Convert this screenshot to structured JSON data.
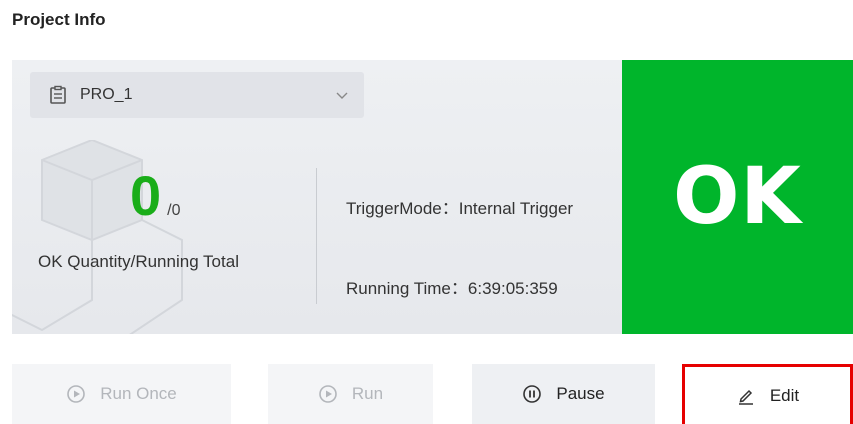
{
  "section": {
    "title": "Project Info"
  },
  "project": {
    "selected": "PRO_1"
  },
  "counter": {
    "ok_count": "0",
    "total": "/0",
    "label": "OK Quantity/Running Total"
  },
  "info": {
    "trigger_mode": "TriggerMode：Internal Trigger",
    "running_time": "Running Time：6:39:05:359"
  },
  "status": {
    "text": "OK",
    "color": "#00b52b"
  },
  "buttons": {
    "run_once": "Run Once",
    "run": "Run",
    "pause": "Pause",
    "edit": "Edit"
  },
  "icons": {
    "project": "document-icon",
    "dropdown": "chevron-down-icon",
    "run_once": "play-circle-icon",
    "run": "play-circle-icon",
    "pause": "pause-circle-icon",
    "edit": "pencil-icon"
  }
}
